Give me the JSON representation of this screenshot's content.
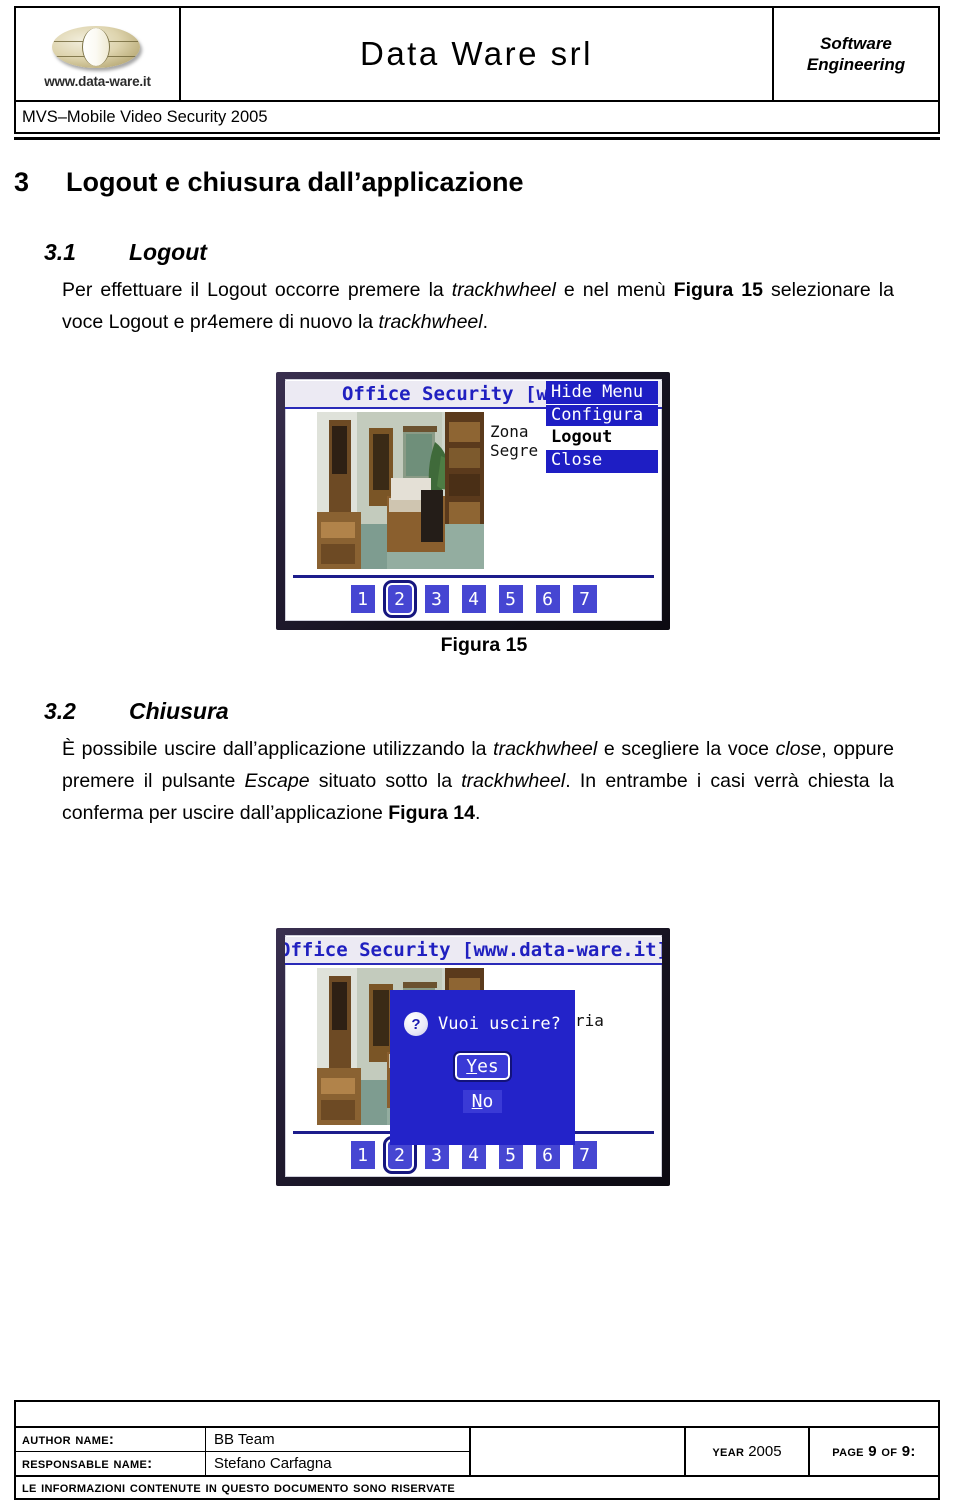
{
  "header": {
    "logo_url": "www.data-ware.it",
    "company": "Data Ware srl",
    "tagline_line1": "Software",
    "tagline_line2": "Engineering",
    "doc_subtitle": "MVS–Mobile Video Security 2005"
  },
  "section": {
    "number": "3",
    "title": "Logout e chiusura dall’applicazione"
  },
  "subsection_logout": {
    "number": "3.1",
    "title": "Logout",
    "paragraph_part1": "Per effettuare il Logout occorre premere la ",
    "paragraph_italic1": "trackhwheel",
    "paragraph_part2": " e nel menù ",
    "paragraph_bold1": "Figura 15",
    "paragraph_part3": " selezionare la voce Logout e pr4emere di nuovo la ",
    "paragraph_italic2": "trackhwheel",
    "paragraph_part4": "."
  },
  "figura15": {
    "caption": "Figura 15",
    "titlebar": "Office Security [www.da",
    "zone_label_line1": "Zona",
    "zone_label_line2": "Segre",
    "menu": [
      {
        "label": "Hide Menu",
        "state": "normal"
      },
      {
        "label": "Configura",
        "state": "normal"
      },
      {
        "label": "Logout",
        "state": "selected"
      },
      {
        "label": "Close",
        "state": "normal"
      }
    ],
    "number_buttons": [
      "1",
      "2",
      "3",
      "4",
      "5",
      "6",
      "7"
    ],
    "selected_button": "2"
  },
  "subsection_chiusura": {
    "number": "3.2",
    "title": "Chiusura",
    "p_part1": "È possibile uscire dall’applicazione utilizzando la ",
    "p_italic1": "trackhwheel",
    "p_part2": " e scegliere la voce ",
    "p_italic2": "close",
    "p_part3": ", oppure premere il pulsante ",
    "p_italic3": "Escape",
    "p_part4": " situato sotto la ",
    "p_italic4": "trackhwheel",
    "p_part5": ". In entrambe i casi verrà chiesta la conferma per uscire dall’applicazione ",
    "p_bold1": "Figura 14",
    "p_part6": "."
  },
  "figura14": {
    "caption": "Figura 14",
    "titlebar": "Office Security [www.data-ware.it]",
    "dialog_icon": "question-mark",
    "dialog_question": "Vuoi uscire?",
    "behind_text": "ria",
    "buttons": [
      {
        "label": "Yes",
        "mnemonic": "Y",
        "default": true
      },
      {
        "label": "No",
        "mnemonic": "N",
        "default": false
      }
    ],
    "number_buttons": [
      "1",
      "2",
      "3",
      "4",
      "5",
      "6",
      "7"
    ],
    "selected_button": "2"
  },
  "footer": {
    "author_label": "Author Name:",
    "author_value": "BB Team",
    "responsable_label": "Responsable Name:",
    "responsable_value": "Stefano Carfagna",
    "year_label": "Year",
    "year_value": "2005",
    "page_label": "Page",
    "page_current": "9",
    "page_of": "of",
    "page_total": "9:",
    "notice": "Le informazioni contenute in questo documento sono riservate"
  },
  "colors": {
    "menu_blue": "#1e1ec4",
    "dialog_blue": "#2323c9",
    "title_blue": "#2020c0",
    "button_blue": "#4646d2",
    "selection_outline": "#16167e"
  }
}
